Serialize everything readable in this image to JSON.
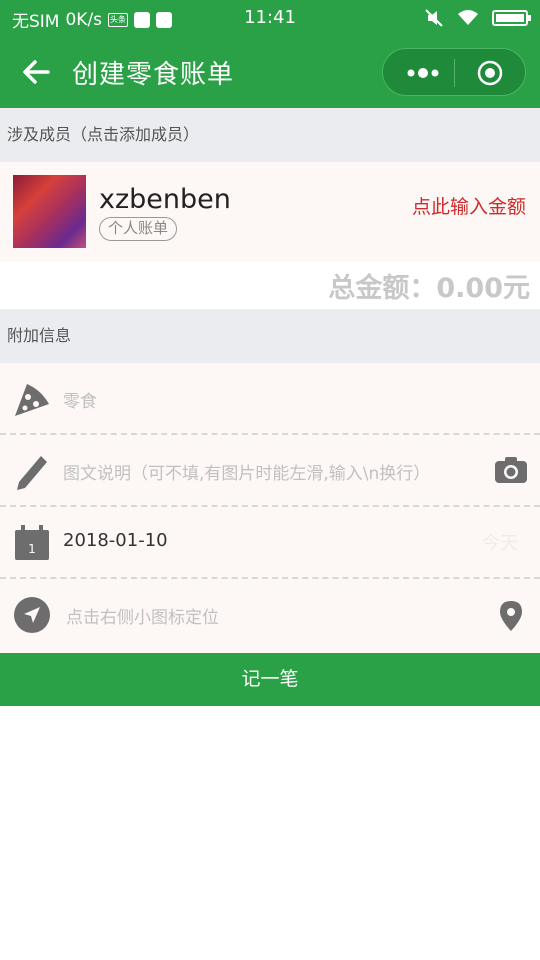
{
  "status_bar": {
    "carrier": "无SIM",
    "speed": "0K/s",
    "mini_badge": "头条",
    "time": "11:41"
  },
  "nav": {
    "title": "创建零食账单"
  },
  "members_section": {
    "header": "涉及成员（点击添加成员）",
    "member": {
      "name": "xzbenben",
      "tag": "个人账单",
      "amount_prompt": "点此输入金额"
    },
    "total": "总金额：0.00元"
  },
  "extra_section": {
    "header": "附加信息",
    "category_placeholder": "零食",
    "description_placeholder": "图文说明（可不填,有图片时能左滑,输入\\n换行）",
    "date": "2018-01-10",
    "date_hint": "今天",
    "location_placeholder": "点击右侧小图标定位"
  },
  "submit_label": "记一笔",
  "colors": {
    "brand_green": "#2aa146",
    "amount_red": "#d12a2a",
    "section_bg": "#eaecf0",
    "row_bg": "#fdf8f6"
  },
  "icons": [
    "back-arrow-icon",
    "more-dots-icon",
    "target-icon",
    "pizza-icon",
    "pencil-icon",
    "camera-icon",
    "calendar-icon",
    "navigation-icon",
    "location-pin-icon"
  ]
}
